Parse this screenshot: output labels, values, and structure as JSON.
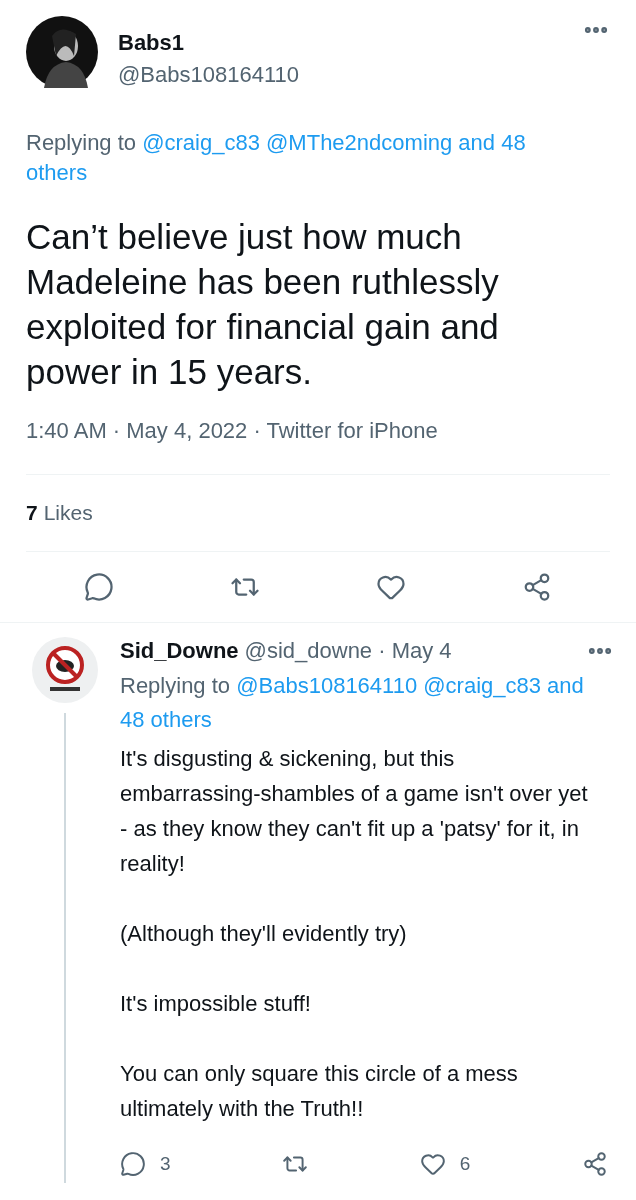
{
  "main_tweet": {
    "name": "Babs1",
    "handle": "@Babs108164110",
    "replying_prefix": "Replying to",
    "replying_to": "@craig_c83 @MThe2ndcoming and 48 others",
    "text": "Can’t believe just how much Madeleine has been ruthlessly exploited for financial gain and power in 15 years.",
    "meta": "1:40 AM · May 4, 2022 · Twitter for iPhone",
    "likes_count": "7",
    "likes_label": "Likes"
  },
  "reply": {
    "name": "Sid_Downe",
    "handle": "@sid_downe · May 4",
    "replying_prefix": "Replying to",
    "replying_to": "@Babs108164110 @craig_c83 and 48 others",
    "paragraphs": [
      "It's disgusting & sickening, but this embarrassing-shambles of a game isn't over yet - as they know they can't fit up a 'patsy' for it, in reality!",
      "(Although they'll evidently try)",
      "It's impossible stuff!",
      "You can only square this circle of a mess ultimately with the Truth!!"
    ],
    "actions": [
      {
        "kind": "reply",
        "count": "3"
      },
      {
        "kind": "retweet"
      },
      {
        "kind": "like",
        "count": "6"
      },
      {
        "kind": "share"
      }
    ]
  },
  "main_actions": [
    {
      "kind": "reply"
    },
    {
      "kind": "retweet"
    },
    {
      "kind": "like"
    },
    {
      "kind": "share"
    }
  ]
}
